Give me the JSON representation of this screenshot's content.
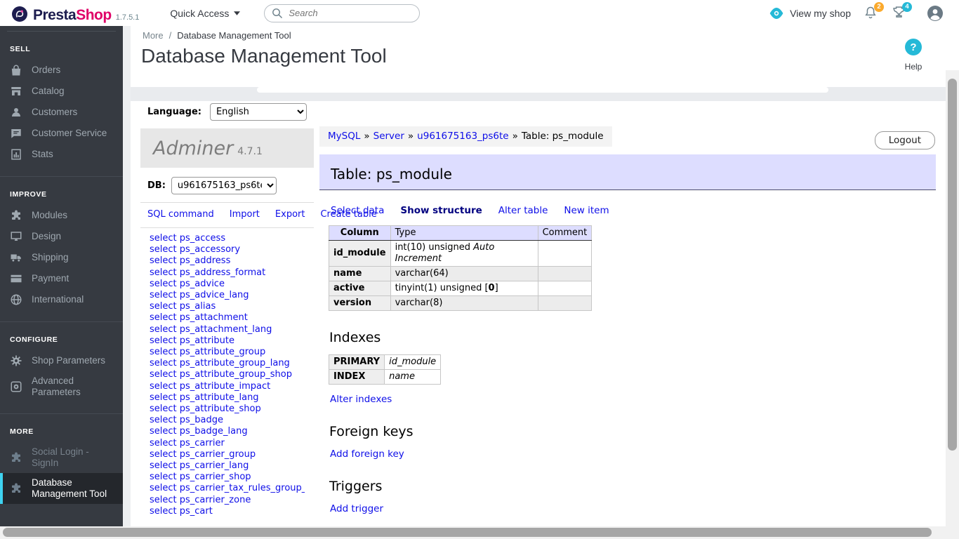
{
  "colors": {
    "accent_cyan": "#25b9d7",
    "active_border": "#3ed2f0",
    "sidebar_bg": "#363a41",
    "brand_navy": "#1d1d4f",
    "brand_pink": "#df0067",
    "link_blue": "#0e0ee8",
    "lavender": "#ddddff",
    "badge_orange": "#fbaa2d",
    "badge_blue": "#25b9d7"
  },
  "topbar": {
    "brand_presta": "Presta",
    "brand_shop": "Shop",
    "version": "1.7.5.1",
    "quick_access": "Quick Access",
    "search_placeholder": "Search",
    "view_my_shop": "View my shop",
    "bell_badge": "2",
    "trophy_badge": "4"
  },
  "sidebar": {
    "sections": [
      {
        "title": "SELL",
        "items": [
          {
            "label": "Orders",
            "icon": "orders"
          },
          {
            "label": "Catalog",
            "icon": "catalog"
          },
          {
            "label": "Customers",
            "icon": "customers"
          },
          {
            "label": "Customer Service",
            "icon": "customer-service"
          },
          {
            "label": "Stats",
            "icon": "stats"
          }
        ]
      },
      {
        "title": "IMPROVE",
        "items": [
          {
            "label": "Modules",
            "icon": "modules"
          },
          {
            "label": "Design",
            "icon": "design"
          },
          {
            "label": "Shipping",
            "icon": "shipping"
          },
          {
            "label": "Payment",
            "icon": "payment"
          },
          {
            "label": "International",
            "icon": "international"
          }
        ]
      },
      {
        "title": "CONFIGURE",
        "items": [
          {
            "label": "Shop Parameters",
            "icon": "gear"
          },
          {
            "label": "Advanced Parameters",
            "icon": "gear-square"
          }
        ]
      },
      {
        "title": "MORE",
        "items": [
          {
            "label": "Social Login - SignIn",
            "icon": "puzzle",
            "muted": true
          },
          {
            "label": "Database Management Tool",
            "icon": "puzzle",
            "active": true
          }
        ]
      }
    ]
  },
  "page": {
    "breadcrumb_parent": "More",
    "breadcrumb_separator": "/",
    "breadcrumb_current": "Database Management Tool",
    "title": "Database Management Tool",
    "help_label": "Help",
    "help_glyph": "?"
  },
  "adminer": {
    "language_label": "Language:",
    "language_value": "English",
    "brand": "Adminer",
    "brand_version": "4.7.1",
    "db_label": "DB:",
    "db_value": "u961675163_ps6te",
    "menu_links": [
      "SQL command",
      "Import",
      "Export",
      "Create table"
    ],
    "select_prefix": "select",
    "tables": [
      "ps_access",
      "ps_accessory",
      "ps_address",
      "ps_address_format",
      "ps_advice",
      "ps_advice_lang",
      "ps_alias",
      "ps_attachment",
      "ps_attachment_lang",
      "ps_attribute",
      "ps_attribute_group",
      "ps_attribute_group_lang",
      "ps_attribute_group_shop",
      "ps_attribute_impact",
      "ps_attribute_lang",
      "ps_attribute_shop",
      "ps_badge",
      "ps_badge_lang",
      "ps_carrier",
      "ps_carrier_group",
      "ps_carrier_lang",
      "ps_carrier_shop",
      "ps_carrier_tax_rules_group_",
      "ps_carrier_zone",
      "ps_cart"
    ],
    "breadcrumb": {
      "links": [
        "MySQL",
        "Server",
        "u961675163_ps6te"
      ],
      "separator": "»",
      "current": "Table: ps_module"
    },
    "logout_label": "Logout",
    "heading": "Table: ps_module",
    "tabs": [
      {
        "label": "Select data",
        "active": false
      },
      {
        "label": "Show structure",
        "active": true
      },
      {
        "label": "Alter table",
        "active": false
      },
      {
        "label": "New item",
        "active": false
      }
    ],
    "structure": {
      "headers": [
        "Column",
        "Type",
        "Comment"
      ],
      "rows": [
        {
          "name": "id_module",
          "type": "int(10) unsigned",
          "extra": "Auto Increment",
          "comment": ""
        },
        {
          "name": "name",
          "type": "varchar(64)",
          "comment": ""
        },
        {
          "name": "active",
          "type": "tinyint(1) unsigned",
          "default": "0",
          "comment": ""
        },
        {
          "name": "version",
          "type": "varchar(8)",
          "comment": ""
        }
      ]
    },
    "indexes": {
      "title": "Indexes",
      "rows": [
        {
          "kind": "PRIMARY",
          "columns": "id_module"
        },
        {
          "kind": "INDEX",
          "columns": "name"
        }
      ],
      "alter_link": "Alter indexes"
    },
    "foreign_keys": {
      "title": "Foreign keys",
      "add_link": "Add foreign key"
    },
    "triggers": {
      "title": "Triggers",
      "add_link": "Add trigger"
    }
  }
}
